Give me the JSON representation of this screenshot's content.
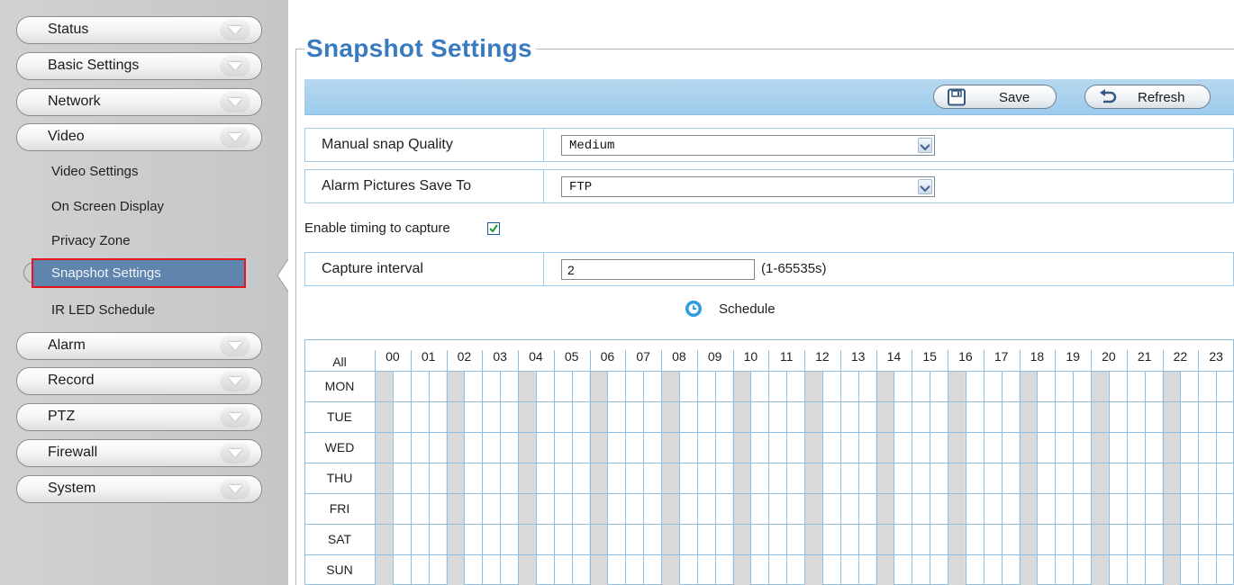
{
  "sidebar": {
    "menu": [
      {
        "label": "Status"
      },
      {
        "label": "Basic Settings"
      },
      {
        "label": "Network"
      },
      {
        "label": "Video"
      },
      {
        "label": "Alarm"
      },
      {
        "label": "Record"
      },
      {
        "label": "PTZ"
      },
      {
        "label": "Firewall"
      },
      {
        "label": "System"
      }
    ],
    "video_submenu": [
      {
        "label": "Video Settings"
      },
      {
        "label": "On Screen Display"
      },
      {
        "label": "Privacy Zone"
      },
      {
        "label": "Snapshot Settings",
        "active": true
      },
      {
        "label": "IR LED Schedule"
      }
    ]
  },
  "page": {
    "title": "Snapshot Settings"
  },
  "toolbar": {
    "save_label": "Save",
    "refresh_label": "Refresh"
  },
  "form": {
    "manual_snap_quality": {
      "label": "Manual snap Quality",
      "value": "Medium"
    },
    "alarm_pictures_save_to": {
      "label": "Alarm Pictures Save To",
      "value": "FTP"
    },
    "enable_timing": {
      "label": "Enable timing to capture",
      "checked": true
    },
    "capture_interval": {
      "label": "Capture interval",
      "value": "2",
      "hint": "(1-65535s)"
    }
  },
  "schedule": {
    "label": "Schedule",
    "all_label": "All",
    "hours": [
      "00",
      "01",
      "02",
      "03",
      "04",
      "05",
      "06",
      "07",
      "08",
      "09",
      "10",
      "11",
      "12",
      "13",
      "14",
      "15",
      "16",
      "17",
      "18",
      "19",
      "20",
      "21",
      "22",
      "23"
    ],
    "days": [
      "MON",
      "TUE",
      "WED",
      "THU",
      "FRI",
      "SAT",
      "SUN"
    ]
  },
  "colors": {
    "accent": "#3a7bbf",
    "toolbar": "#a9d2ee",
    "grid_line": "#8fbfe0",
    "grid_shade": "#d9d9d9",
    "highlight_border": "#e8141c",
    "active_item_bg": "#5f84ad"
  },
  "icons": {
    "save": "floppy-disk-icon",
    "refresh": "refresh-arrow-icon",
    "schedule": "clock-icon",
    "checkbox": "checkmark-icon"
  }
}
